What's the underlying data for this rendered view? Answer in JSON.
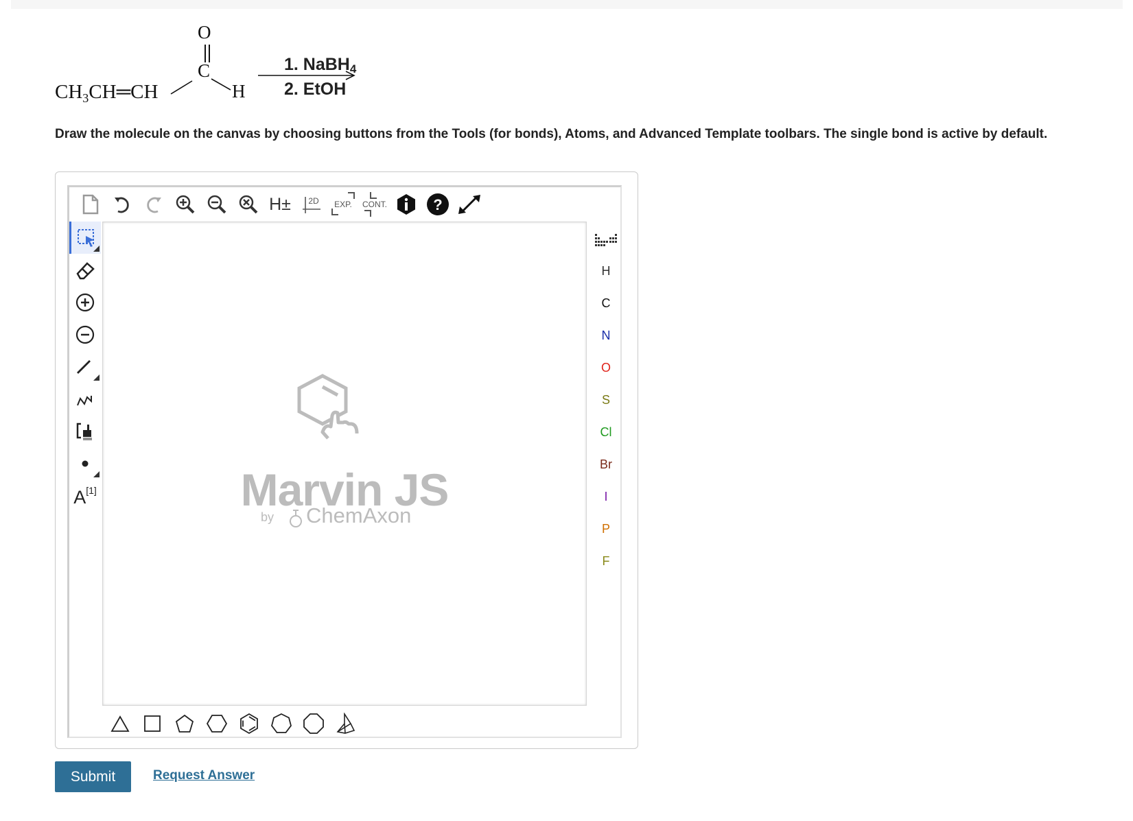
{
  "question": {
    "reactant": {
      "oxygen": "O",
      "carbon": "C",
      "main_prefix": "CH",
      "main_sub": "3",
      "main_rest": "CH═CH",
      "hydrogen": "H"
    },
    "reagents": {
      "step1_prefix": "1. NaBH",
      "step1_sub": "4",
      "step2": "2. EtOH"
    },
    "instructions": "Draw the molecule on the canvas by choosing buttons from the Tools (for bonds), Atoms, and Advanced Template toolbars. The single bond is active by default."
  },
  "editor": {
    "top_toolbar": {
      "h_label": "H±",
      "clean2d_label": "2D",
      "expand_label": "EXP.",
      "contract_label": "CONT."
    },
    "left_toolbar": {
      "atom_map_label": "A",
      "atom_map_sup": "[1]"
    },
    "atoms": [
      {
        "symbol": "H",
        "color": "#333333"
      },
      {
        "symbol": "C",
        "color": "#111111"
      },
      {
        "symbol": "N",
        "color": "#1a2ea8"
      },
      {
        "symbol": "O",
        "color": "#e0241b"
      },
      {
        "symbol": "S",
        "color": "#7a7a15"
      },
      {
        "symbol": "Cl",
        "color": "#1f9a1f"
      },
      {
        "symbol": "Br",
        "color": "#7a2a1a"
      },
      {
        "symbol": "I",
        "color": "#7a1aa8"
      },
      {
        "symbol": "P",
        "color": "#d06f00"
      },
      {
        "symbol": "F",
        "color": "#8a8a1a"
      }
    ],
    "canvas_logo": {
      "title": "Marvin JS",
      "by": "by",
      "company": "ChemAxon"
    }
  },
  "actions": {
    "submit_label": "Submit",
    "request_label": "Request Answer"
  }
}
